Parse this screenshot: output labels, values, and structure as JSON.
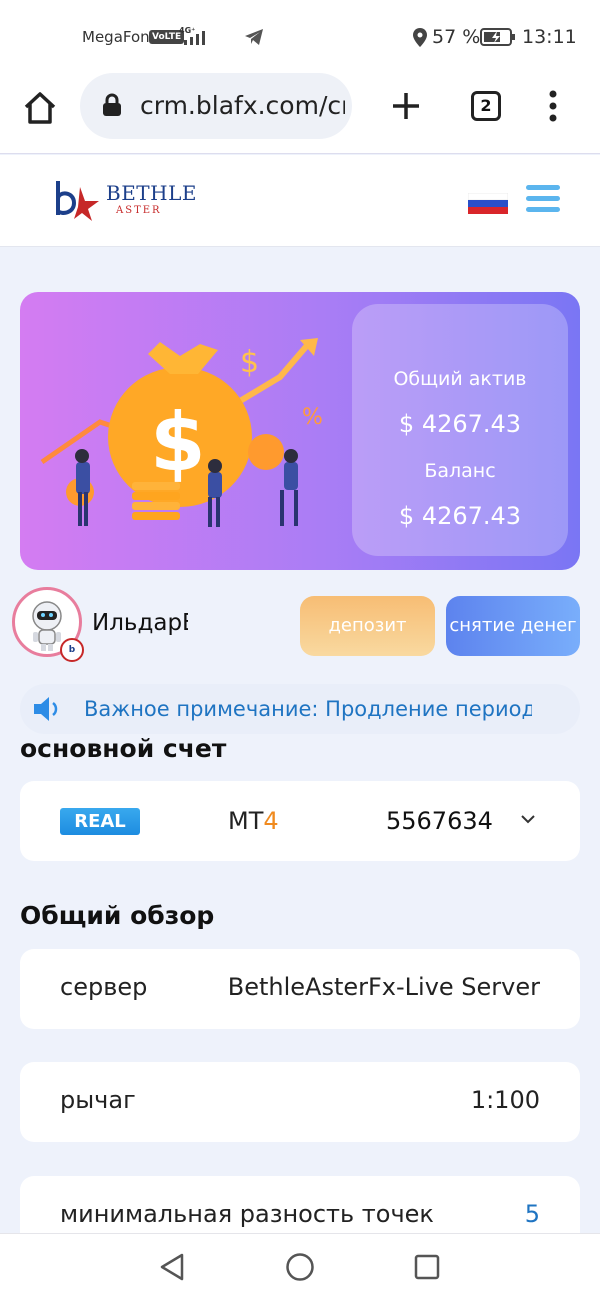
{
  "status_bar": {
    "carrier": "MegaFon",
    "volte": "VoLTE",
    "network": "4G⁺",
    "battery_pct": "57 %",
    "time": "13:11"
  },
  "browser": {
    "url": "crm.blafx.com/cr",
    "tab_count": "2"
  },
  "header": {
    "logo_main": "BETHLE",
    "logo_sub": "ASTER",
    "colors": {
      "accent": "#5bb5ee",
      "brand_blue": "#1c3f8a",
      "brand_red": "#c62828"
    }
  },
  "banner": {
    "total_assets_label": "Общий актив",
    "total_assets_value": "$ 4267.43",
    "balance_label": "Баланс",
    "balance_value": "$ 4267.43"
  },
  "user": {
    "name": "ИльдарЕ",
    "deposit_label": "депозит",
    "withdraw_label": "снятие денег"
  },
  "notice": {
    "text": "Важное примечание: Продление период"
  },
  "main_account": {
    "title": "основной счет",
    "type_badge": "REAL",
    "platform_prefix": "MT",
    "platform_num": "4",
    "account_number": "5567634"
  },
  "overview": {
    "title": "Общий обзор",
    "rows": [
      {
        "label": "сервер",
        "value": "BethleAsterFx-Live Server"
      },
      {
        "label": "рычаг",
        "value": "1:100"
      },
      {
        "label": "минимальная разность точек",
        "value": "5"
      }
    ]
  }
}
